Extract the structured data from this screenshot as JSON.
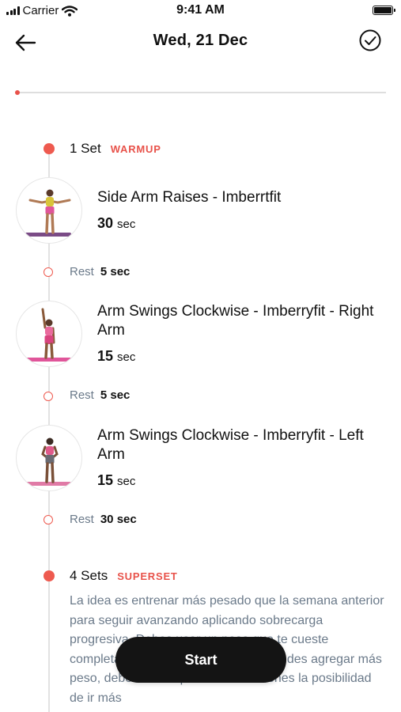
{
  "status_bar": {
    "carrier": "Carrier",
    "time": "9:41 AM"
  },
  "header": {
    "title": "Wed, 21 Dec"
  },
  "sets": [
    {
      "count": "1 Set",
      "tag": "WARMUP",
      "exercises": [
        {
          "name": "Side Arm Raises - Imberrtfit",
          "duration": "30",
          "unit": "sec",
          "rest_label": "Rest",
          "rest_value": "5 sec"
        },
        {
          "name": "Arm Swings Clockwise - Imberryfit - Right Arm",
          "duration": "15",
          "unit": "sec",
          "rest_label": "Rest",
          "rest_value": "5 sec"
        },
        {
          "name": "Arm Swings Clockwise - Imberryfit - Left Arm",
          "duration": "15",
          "unit": "sec",
          "rest_label": "Rest",
          "rest_value": "30 sec"
        }
      ]
    },
    {
      "count": "4 Sets",
      "tag": "SUPERSET",
      "description": "La idea es entrenar más pesado que la semana anterior para seguir avanzando aplicando sobrecarga progresiva. Debes usar un peso que te cueste completar cada rep, si sientes que puedes agregar más peso, debes ir mas pesado. Si no tienes la posibilidad de ir más"
    }
  ],
  "start_button": {
    "label": "Start"
  },
  "colors": {
    "accent": "#e8524a",
    "button": "#141414",
    "muted_text": "#6b7a8a"
  },
  "icons": {
    "back": "arrow-left-icon",
    "done": "check-circle-icon"
  }
}
